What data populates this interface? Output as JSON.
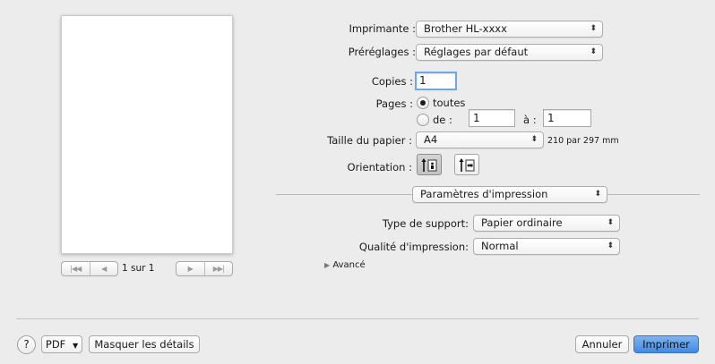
{
  "preview": {
    "page_info": "1 sur 1",
    "nav_first_icon": "first-page-icon",
    "nav_prev_icon": "previous-page-icon",
    "nav_next_icon": "next-page-icon",
    "nav_last_icon": "last-page-icon"
  },
  "printer": {
    "label": "Imprimante :",
    "value": "Brother HL-xxxx"
  },
  "presets": {
    "label": "Préréglages :",
    "value": "Réglages par défaut"
  },
  "copies": {
    "label": "Copies :",
    "value": "1"
  },
  "pages": {
    "label": "Pages :",
    "all_label": "toutes",
    "range_label": "de :",
    "from": "1",
    "to_label": "à :",
    "to": "1",
    "selected": "toutes"
  },
  "paper": {
    "label": "Taille du papier :",
    "value": "A4",
    "dimensions": "210 par 297 mm"
  },
  "orientation": {
    "label": "Orientation :",
    "portrait_icon": "portrait-orientation-icon",
    "landscape_icon": "landscape-orientation-icon",
    "selected": "portrait"
  },
  "section": {
    "value": "Paramètres d'impression"
  },
  "media_type": {
    "label": "Type de support:",
    "value": "Papier ordinaire"
  },
  "quality": {
    "label": "Qualité d'impression:",
    "value": "Normal"
  },
  "advanced": {
    "label": "Avancé"
  },
  "footer": {
    "help_label": "?",
    "pdf_label": "PDF",
    "hide_details_label": "Masquer les détails",
    "cancel_label": "Annuler",
    "print_label": "Imprimer"
  },
  "colors": {
    "accent": "#3f8ae6",
    "focus_ring": "#6ea6e8",
    "background": "#ececec"
  }
}
